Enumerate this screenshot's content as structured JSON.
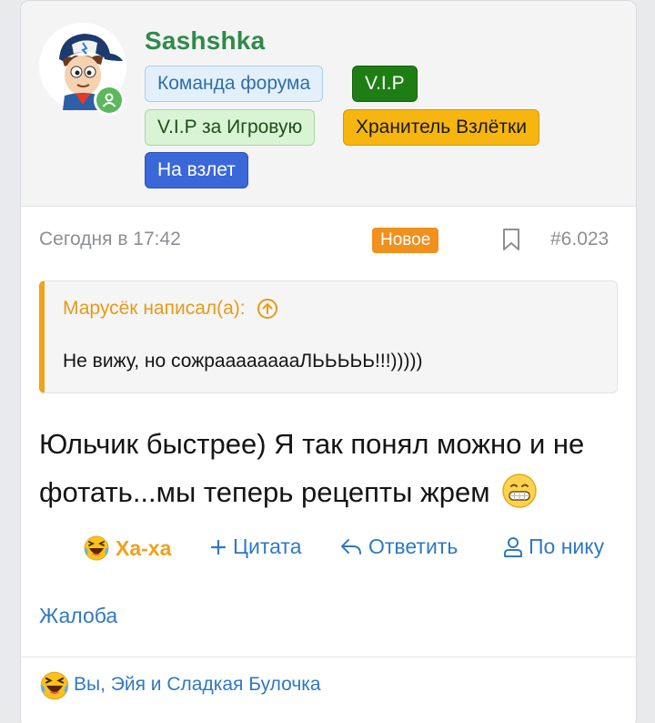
{
  "user": {
    "name": "Sashshka",
    "status": "online",
    "badges": {
      "team": "Команда форума",
      "vip": "V.I.P",
      "vip_game": "V.I.P за Игровую",
      "keeper": "Хранитель Взлётки",
      "fly": "На взлет"
    }
  },
  "meta": {
    "date": "Сегодня в 17:42",
    "new_label": "Новое",
    "post_number": "#6.023"
  },
  "quote": {
    "author": "Марусёк написал(а):",
    "text": "Не вижу, но сожрааааааааЛЬЬЬЬЬ!!!)))))"
  },
  "message": {
    "text": "Юльчик быстрее) Я так понял можно и не фотать...мы теперь рецепты жрем"
  },
  "actions": {
    "haha": "Ха-ха",
    "quote": "Цитата",
    "reply": "Ответить",
    "by_nick": "По нику",
    "complaint": "Жалоба"
  },
  "reactions": {
    "text": "Вы, Эйя и Сладкая Булочка"
  },
  "colors": {
    "accent_link": "#2f79c4",
    "quote_accent": "#f0a21b",
    "username": "#2f8a4a"
  }
}
